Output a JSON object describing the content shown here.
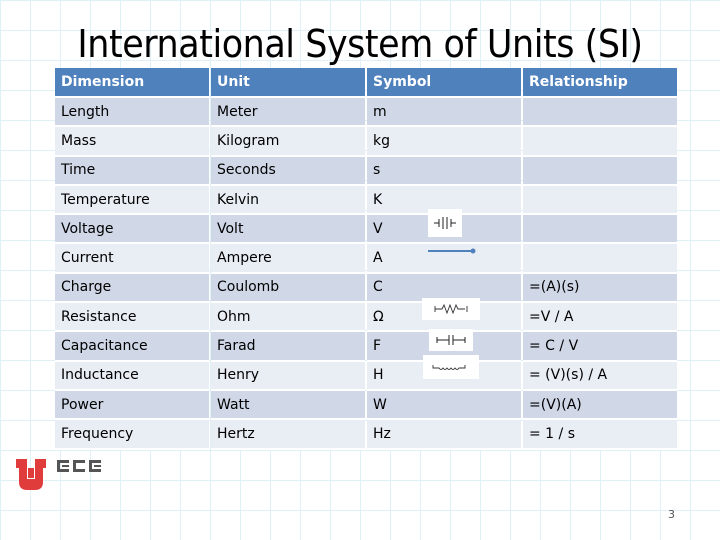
{
  "slide": {
    "title": "International System of Units (SI)",
    "page_number": "3"
  },
  "table": {
    "headers": [
      "Dimension",
      "Unit",
      "Symbol",
      "Relationship"
    ],
    "rows": [
      {
        "dimension": "Length",
        "unit": "Meter",
        "symbol": "m",
        "relationship": ""
      },
      {
        "dimension": "Mass",
        "unit": "Kilogram",
        "symbol": "kg",
        "relationship": ""
      },
      {
        "dimension": "Time",
        "unit": "Seconds",
        "symbol": "s",
        "relationship": ""
      },
      {
        "dimension": "Temperature",
        "unit": "Kelvin",
        "symbol": "K",
        "relationship": ""
      },
      {
        "dimension": "Voltage",
        "unit": "Volt",
        "symbol": "V",
        "relationship": ""
      },
      {
        "dimension": "Current",
        "unit": "Ampere",
        "symbol": "A",
        "relationship": ""
      },
      {
        "dimension": "Charge",
        "unit": "Coulomb",
        "symbol": "C",
        "relationship": "=(A)(s)"
      },
      {
        "dimension": "Resistance",
        "unit": "Ohm",
        "symbol": "Ω",
        "relationship": "=V / A"
      },
      {
        "dimension": "Capacitance",
        "unit": "Farad",
        "symbol": "F",
        "relationship": "= C / V"
      },
      {
        "dimension": "Inductance",
        "unit": "Henry",
        "symbol": "H",
        "relationship": "= (V)(s) / A"
      },
      {
        "dimension": "Power",
        "unit": "Watt",
        "symbol": "W",
        "relationship": "=(V)(A)"
      },
      {
        "dimension": "Frequency",
        "unit": "Hertz",
        "symbol": "Hz",
        "relationship": "= 1 / s"
      }
    ]
  },
  "circuit_symbols": [
    {
      "row": "Voltage",
      "icon": "battery-icon"
    },
    {
      "row": "Current",
      "icon": "current-arrow-icon"
    },
    {
      "row": "Resistance",
      "icon": "resistor-icon"
    },
    {
      "row": "Capacitance",
      "icon": "capacitor-icon"
    },
    {
      "row": "Inductance",
      "icon": "inductor-icon"
    }
  ],
  "logo": {
    "text": "ECE",
    "accent_color": "#e03c3c",
    "text_color": "#555555"
  },
  "colors": {
    "header": "#4f81bd",
    "row_odd": "#d0d8e8",
    "row_even": "#e9edf4"
  }
}
